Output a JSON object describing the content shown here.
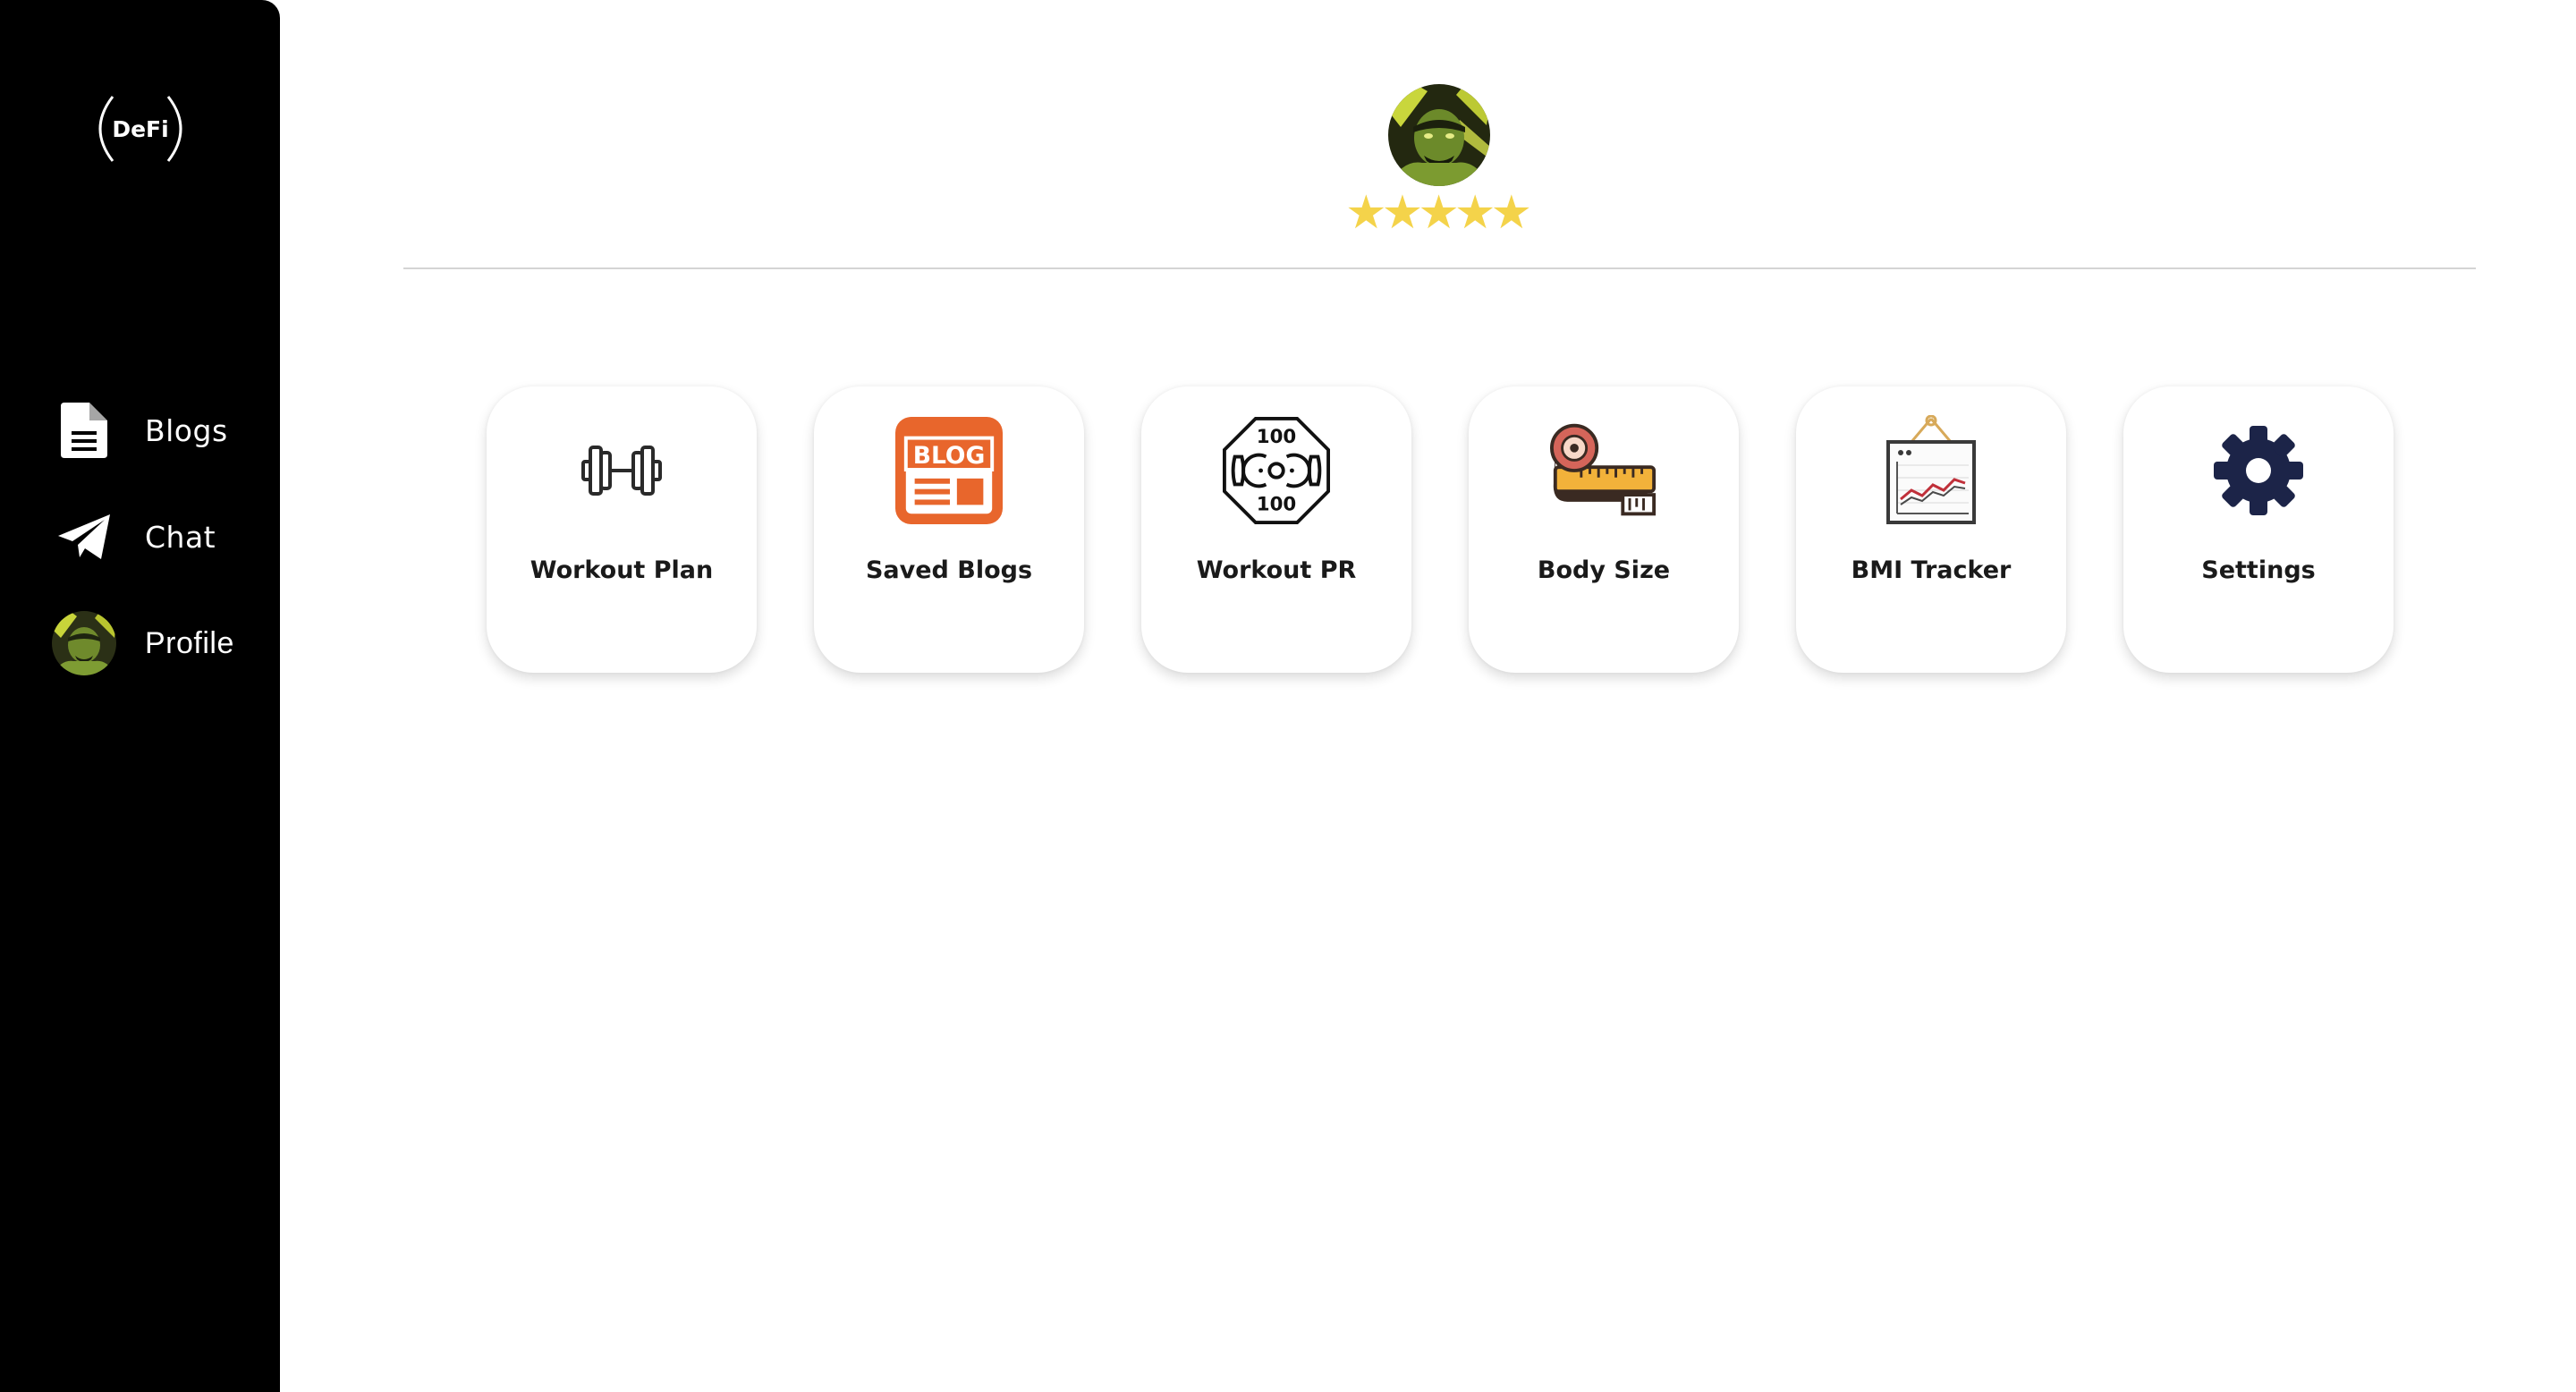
{
  "sidebar": {
    "logo": "DeFi",
    "items": [
      {
        "label": "Blogs",
        "icon": "document-icon"
      },
      {
        "label": "Chat",
        "icon": "send-icon"
      },
      {
        "label": "Profile",
        "icon": "avatar"
      }
    ]
  },
  "profile": {
    "rating": 5,
    "stars": "★★★★★"
  },
  "cards": [
    {
      "label": "Workout Plan",
      "icon": "dumbbell-icon"
    },
    {
      "label": "Saved Blogs",
      "icon": "blog-icon",
      "icon_text": "BLOG"
    },
    {
      "label": "Workout PR",
      "icon": "weight-plate-icon",
      "icon_text_top": "100",
      "icon_text_bottom": "100"
    },
    {
      "label": "Body Size",
      "icon": "measuring-tape-icon"
    },
    {
      "label": "BMI Tracker",
      "icon": "chart-board-icon"
    },
    {
      "label": "Settings",
      "icon": "gear-icon"
    }
  ],
  "colors": {
    "sidebar_bg": "#000000",
    "star": "#f4d34a",
    "blog_orange": "#e8662c",
    "gear_navy": "#1c2448"
  }
}
